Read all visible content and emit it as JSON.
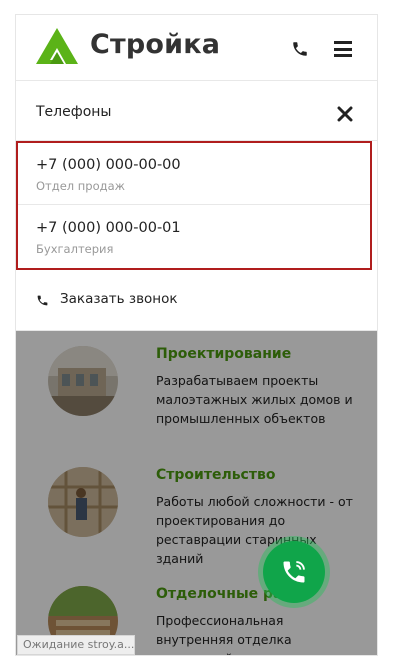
{
  "header": {
    "brand": "Стройка",
    "logo_color": "#5bb318",
    "icons": [
      "phone-icon",
      "hamburger-menu-icon"
    ]
  },
  "services": [
    {
      "title": "Проектирование",
      "description": "Разрабатываем проекты малоэтажных жилых домов и промышленных объектов"
    },
    {
      "title": "Строительство",
      "description": "Работы любой сложности - от проектирования до реставрации старинных зданий"
    },
    {
      "title": "Отделочные ра",
      "description": "Профессиональная внутренняя отделка помещений, четкое соответствие дизайн проекту."
    }
  ],
  "dropdown": {
    "title": "Телефоны",
    "phones": [
      {
        "number": "+7 (000) 000-00-00",
        "label": "Отдел продаж"
      },
      {
        "number": "+7 (000) 000-00-01",
        "label": "Бухгалтерия"
      }
    ],
    "callback_label": "Заказать звонок",
    "highlight_color": "#b01d1d"
  },
  "status_text": "Ожидание stroy.a...",
  "accent_green": "#4b9b10",
  "fab_color": "#10a54a"
}
